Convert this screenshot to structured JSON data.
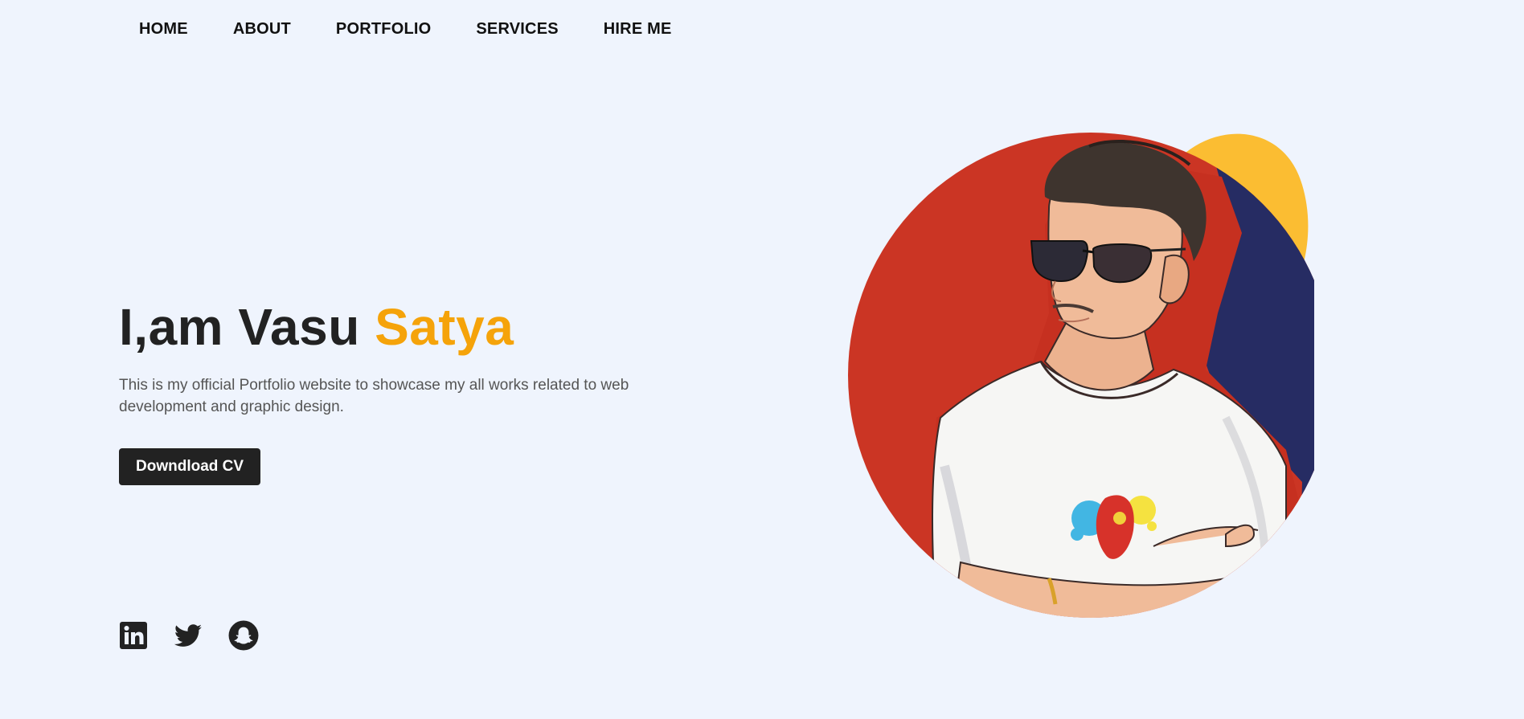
{
  "nav": {
    "items": [
      {
        "label": "HOME"
      },
      {
        "label": "ABOUT"
      },
      {
        "label": "PORTFOLIO"
      },
      {
        "label": "SERVICES"
      },
      {
        "label": "HIRE ME"
      }
    ]
  },
  "hero": {
    "title_prefix": "I,am Vasu",
    "title_accent": "Satya",
    "description": "This is my official Portfolio website to showcase my all works related to web development and graphic design.",
    "cta_label": "Downdload CV"
  },
  "social": {
    "icons": [
      "linkedin-icon",
      "twitter-icon",
      "snapchat-icon"
    ]
  },
  "colors": {
    "background": "#eff4fd",
    "accent": "#f5a30a",
    "button": "#222222",
    "avatar_red": "#cb3524",
    "avatar_navy": "#262c63",
    "avatar_yellow": "#fbbd32"
  }
}
